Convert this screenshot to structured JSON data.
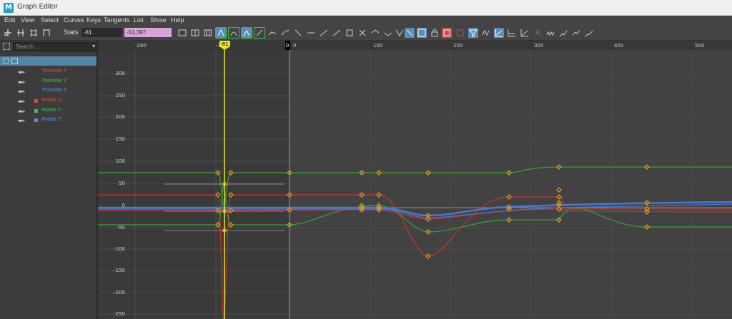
{
  "window": {
    "title": "Graph Editor",
    "logo": "M"
  },
  "menu": [
    "Edit",
    "View",
    "Select",
    "Curves",
    "Keys",
    "Tangents",
    "List",
    "Show",
    "Help"
  ],
  "toolbar": {
    "stats_label": "Stats",
    "time_value": "-81",
    "key_value": "-51.397"
  },
  "outliner": {
    "search_placeholder": "Search...",
    "channels": [
      {
        "label": "Translate X",
        "color": "#e04848",
        "icon": "curve-icon"
      },
      {
        "label": "Translate Y",
        "color": "#48c048",
        "icon": "curve-icon"
      },
      {
        "label": "Translate Z",
        "color": "#5a8de0",
        "icon": "curve-icon"
      },
      {
        "label": "Rotate X",
        "color": "#e04848",
        "icon": "square-icon"
      },
      {
        "label": "Rotate Y",
        "color": "#48c048",
        "icon": "square-icon"
      },
      {
        "label": "Rotate Z",
        "color": "#5a8de0",
        "icon": "square-icon"
      }
    ]
  },
  "graph": {
    "x_ticks": [
      "-200",
      "-100",
      "0",
      "100",
      "200",
      "300",
      "400",
      "500"
    ],
    "y_ticks": [
      "300",
      "250",
      "200",
      "150",
      "100",
      "50",
      "0",
      "-50",
      "-100",
      "-150",
      "-200",
      "-250"
    ],
    "current_time_label": "-81",
    "zero_marker_label": "0",
    "colors": {
      "red": "#c83232",
      "green": "#3ca03c",
      "blue": "#4a78d0",
      "key": "#e0a020",
      "current_time": "#e8e820"
    }
  }
}
